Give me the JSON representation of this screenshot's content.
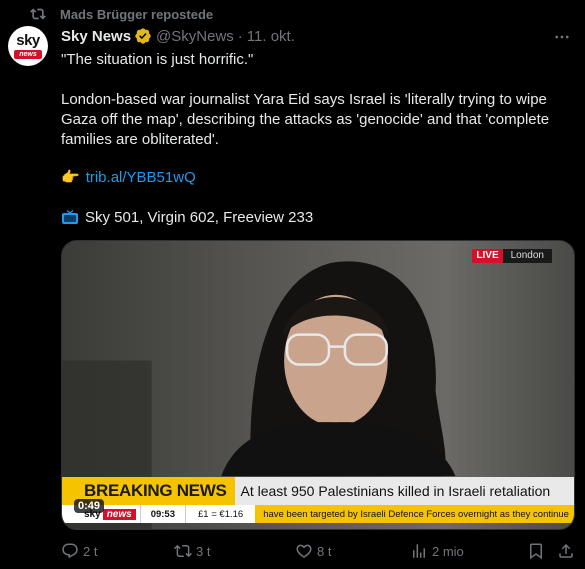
{
  "repost": {
    "label": "Mads Brügger repostede",
    "icon": "repost-icon"
  },
  "author": {
    "avatar_text_top": "sky",
    "avatar_text_bottom": "news",
    "name": "Sky News",
    "handle": "@SkyNews",
    "separator": "·",
    "date": "11. okt."
  },
  "post": {
    "quote": "\"The situation is just horrific.\"",
    "paragraph": "London-based war journalist Yara Eid says Israel is 'literally trying to wipe Gaza off the map', describing the attacks as 'genocide' and that 'complete families are obliterated'.",
    "link_emoji": "👉",
    "link": "trib.al/YBB51wQ",
    "channels": "Sky 501, Virgin 602, Freeview 233"
  },
  "media": {
    "live_label": "LIVE",
    "live_location": "London",
    "breaking_label": "BREAKING NEWS",
    "headline": "At least 950 Palestinians killed in Israeli retaliation",
    "ticker_logo": "sky",
    "ticker_logo_news": "news",
    "ticker_time": "09:53",
    "ticker_fx": "£1 = €1.16",
    "ticker_scroll": "have been targeted by Israeli Defence Forces overnight as they continue",
    "duration": "0:49"
  },
  "actions": {
    "replies": "2 t",
    "reposts": "3 t",
    "likes": "8 t",
    "views": "2 mio"
  },
  "colors": {
    "background": "#000000",
    "secondary_text": "#71767b",
    "link": "#1d9bf0",
    "verified_badge": "#e2b719",
    "sky_red": "#d5102a",
    "breaking_yellow": "#f5c400"
  }
}
